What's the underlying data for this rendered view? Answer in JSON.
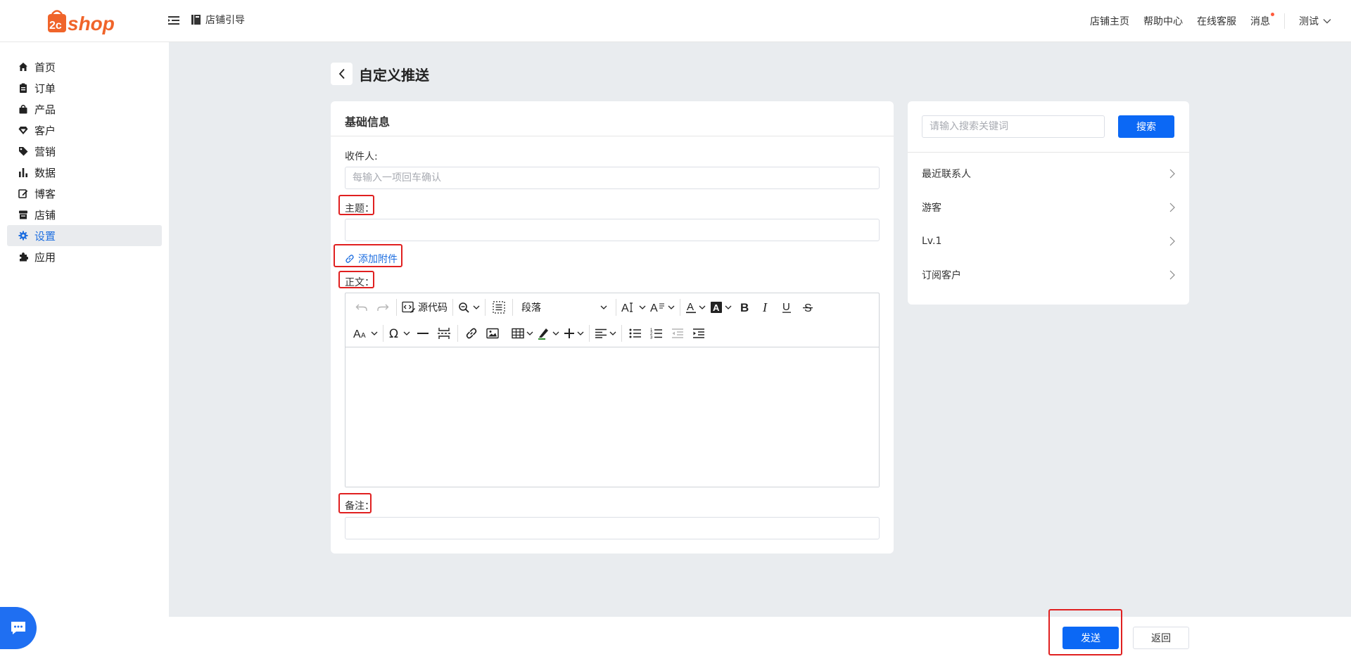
{
  "brand": {
    "logo_text": "2cshop",
    "accent": "#f0642a"
  },
  "header": {
    "menu_icon": "menu-fold-icon",
    "guide_label": "店铺引导",
    "links": [
      "店铺主页",
      "帮助中心",
      "在线客服",
      "消息"
    ],
    "user_label": "测试"
  },
  "sidebar": {
    "items": [
      {
        "label": "首页",
        "icon": "home-icon"
      },
      {
        "label": "订单",
        "icon": "clipboard-icon"
      },
      {
        "label": "产品",
        "icon": "shopping-bag-icon"
      },
      {
        "label": "客户",
        "icon": "diamond-icon"
      },
      {
        "label": "营销",
        "icon": "tag-icon"
      },
      {
        "label": "数据",
        "icon": "bar-chart-icon"
      },
      {
        "label": "博客",
        "icon": "edit-icon"
      },
      {
        "label": "店铺",
        "icon": "store-icon"
      },
      {
        "label": "设置",
        "icon": "gear-icon"
      },
      {
        "label": "应用",
        "icon": "puzzle-icon"
      }
    ],
    "active_index": 8
  },
  "page": {
    "title": "自定义推送"
  },
  "form": {
    "section_title": "基础信息",
    "recipient_label": "收件人:",
    "recipient_placeholder": "每输入一项回车确认",
    "subject_label": "主题：",
    "subject_value": "",
    "attach_label": "添加附件",
    "body_label": "正文：",
    "note_label": "备注：",
    "note_value": ""
  },
  "editor": {
    "source_code_label": "源代码",
    "paragraph_value": "段落",
    "body_content": ""
  },
  "right_panel": {
    "search_placeholder": "请输入搜索关键词",
    "search_button": "搜索",
    "groups": [
      "最近联系人",
      "游客",
      "Lv.1",
      "订阅客户"
    ]
  },
  "footer": {
    "send_button": "发送",
    "return_button": "返回"
  },
  "colors": {
    "primary": "#0b68f5",
    "highlight_box": "#e02020"
  }
}
